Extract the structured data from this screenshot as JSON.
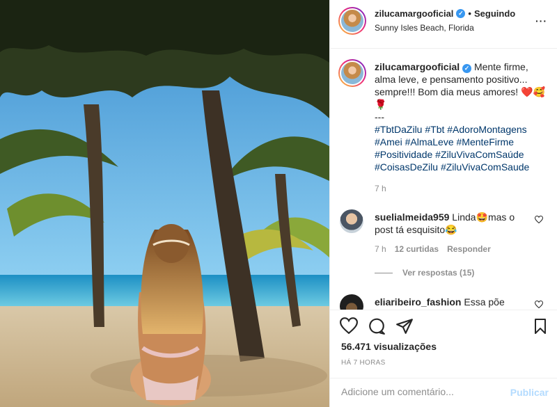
{
  "header": {
    "username": "zilucamargooficial",
    "separator": "•",
    "follow_label": "Seguindo",
    "location": "Sunny Isles Beach, Florida",
    "more_label": "···"
  },
  "caption": {
    "username": "zilucamargooficial",
    "text": "Mente firme, alma leve, e pensamento positivo... sempre!!! Bom dia meus amores! ❤️🥰🌹",
    "separator": "---",
    "hashtags": [
      "#TbtDaZilu",
      "#Tbt",
      "#AdoroMontagens",
      "#Amei",
      "#AlmaLeve",
      "#MenteFirme",
      "#Positividade",
      "#ZiluVivaComSaúde",
      "#CoisasDeZilu",
      "#ZiluVivaComSaude"
    ],
    "time": "7 h"
  },
  "comments": [
    {
      "username": "suelialmeida959",
      "text": "Linda🤩mas o post tá esquisito😂",
      "time": "7 h",
      "likes": "12 curtidas",
      "reply_label": "Responder",
      "view_replies": "Ver respostas (15)"
    },
    {
      "username": "eliaribeiro_fashion",
      "text": "Essa põe"
    }
  ],
  "actions": {
    "views": "56.471 visualizações",
    "posted_ago": "HÁ 7 HORAS"
  },
  "composer": {
    "placeholder": "Adicione um comentário...",
    "publish_label": "Publicar"
  },
  "icons": {
    "verified": "verified-badge-icon",
    "like": "heart-icon",
    "comment": "comment-bubble-icon",
    "share": "paper-plane-icon",
    "save": "bookmark-icon",
    "comment_like": "small-heart-icon"
  },
  "colors": {
    "link_blue": "#00376b",
    "verified_blue": "#3897f0",
    "muted_gray": "#8e8e8e",
    "publish_disabled": "#b3dbff"
  }
}
